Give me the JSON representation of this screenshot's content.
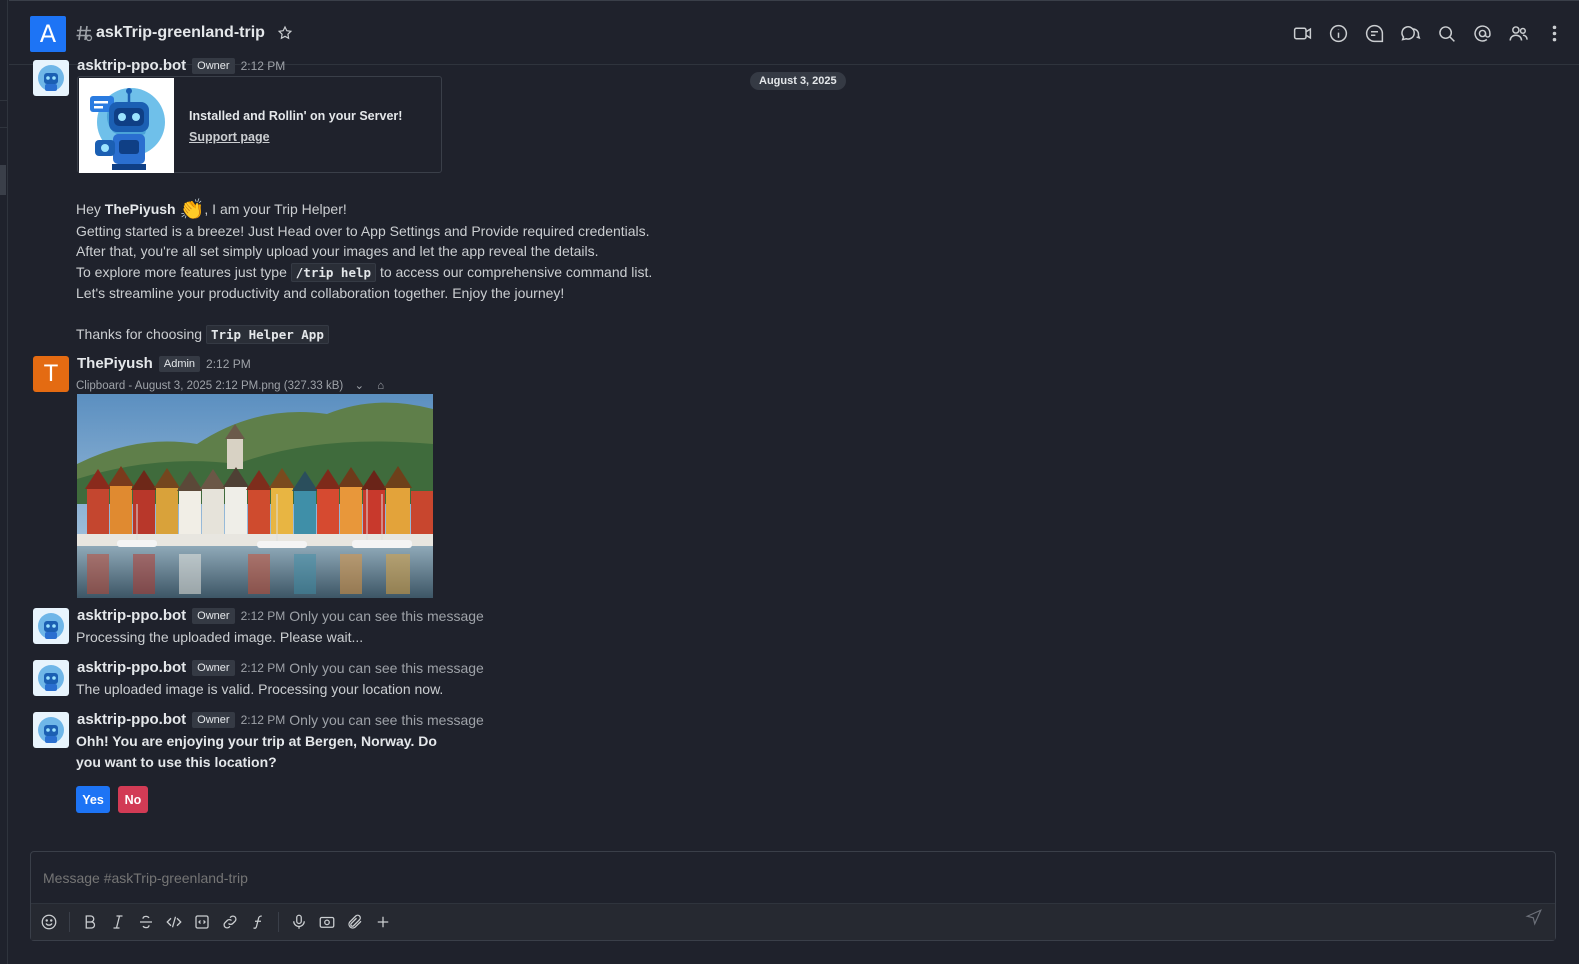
{
  "header": {
    "room_initial": "A",
    "room_name": "askTrip-greenland-trip",
    "icons": [
      "video-icon",
      "info-icon",
      "threads-icon",
      "discussion-icon",
      "search-icon",
      "mention-icon",
      "members-icon",
      "kebab-icon"
    ]
  },
  "date_divider": "August 3, 2025",
  "bot_first": {
    "username": "asktrip-ppo.bot",
    "role": "Owner",
    "time": "2:12 PM",
    "card_title": "Installed and Rollin' on your Server!",
    "card_link": "Support page",
    "greeting_pre": "Hey",
    "greeting_name": "ThePiyush",
    "greeting_emoji": "👏",
    "greeting_post": ", I am your Trip Helper!",
    "line1": "Getting started is a breeze! Just Head over to App Settings and Provide required credentials.",
    "line2": "After that, you're all set simply upload your images and let the app reveal the details.",
    "line3_pre": "To explore more features just type",
    "line3_code": "/trip help",
    "line3_post": "to access our comprehensive command list.",
    "line4": "Let's streamline your productivity and collaboration together. Enjoy the journey!",
    "thanks_pre": "Thanks for choosing",
    "thanks_code": "Trip Helper App"
  },
  "user_msg": {
    "initial": "T",
    "username": "ThePiyush",
    "role": "Admin",
    "time": "2:12 PM",
    "attachment": "Clipboard - August 3, 2025 2:12 PM.png (327.33 kB)"
  },
  "bot_replies": [
    {
      "username": "asktrip-ppo.bot",
      "role": "Owner",
      "time": "2:12 PM",
      "private": "Only you can see this message",
      "text": "Processing the uploaded image. Please wait..."
    },
    {
      "username": "asktrip-ppo.bot",
      "role": "Owner",
      "time": "2:12 PM",
      "private": "Only you can see this message",
      "text": "The uploaded image is valid. Processing your location now."
    },
    {
      "username": "asktrip-ppo.bot",
      "role": "Owner",
      "time": "2:12 PM",
      "private": "Only you can see this message",
      "text_line1": "Ohh! You are enjoying your trip at Bergen, Norway. Do",
      "text_line2": "you want to use this location?"
    }
  ],
  "buttons": {
    "yes": "Yes",
    "no": "No",
    "yes_color": "#1d74f5",
    "no_color": "#d23b55"
  },
  "composer": {
    "placeholder": "Message #askTrip-greenland-trip"
  }
}
